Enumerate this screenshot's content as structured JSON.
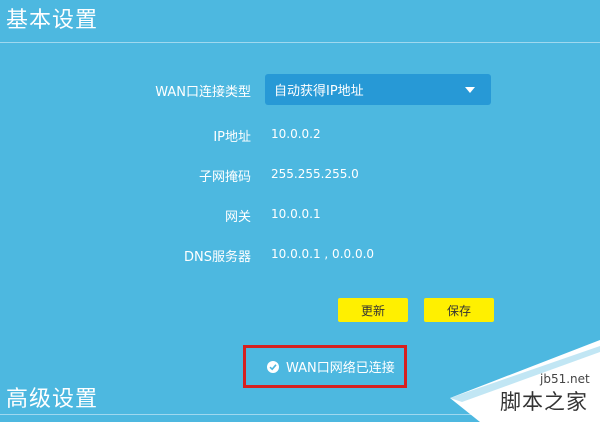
{
  "sections": {
    "basic_title": "基本设置",
    "advanced_title": "高级设置"
  },
  "wan": {
    "type_label": "WAN口连接类型",
    "type_value": "自动获得IP地址",
    "ip_label": "IP地址",
    "ip_value": "10.0.0.2",
    "mask_label": "子网掩码",
    "mask_value": "255.255.255.0",
    "gateway_label": "网关",
    "gateway_value": "10.0.0.1",
    "dns_label": "DNS服务器",
    "dns_value": "10.0.0.1 , 0.0.0.0"
  },
  "buttons": {
    "refresh": "更新",
    "save": "保存"
  },
  "status": {
    "icon": "check-circle-icon",
    "text": "WAN口网络已连接"
  },
  "watermark": {
    "url": "jb51.net",
    "name": "脚本之家"
  },
  "colors": {
    "background": "#4db8e0",
    "select_bg": "#2799d6",
    "button_bg": "#fff000",
    "highlight_border": "#d62020"
  }
}
